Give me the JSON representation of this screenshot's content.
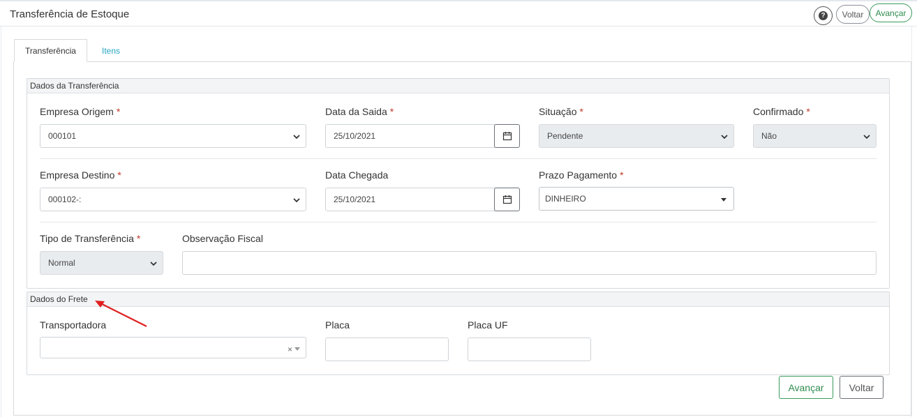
{
  "header": {
    "title": "Transferência de Estoque",
    "help_label": "?",
    "back_label": "Voltar",
    "next_label": "Avançar"
  },
  "tabs": [
    {
      "label": "Transferência",
      "active": true
    },
    {
      "label": "Itens",
      "active": false
    }
  ],
  "transfer_section": {
    "legend": "Dados da Transferência",
    "empresa_origem": {
      "label": "Empresa Origem",
      "required": "*",
      "value": "000101"
    },
    "data_saida": {
      "label": "Data da Saida",
      "required": "*",
      "value": "25/10/2021"
    },
    "situacao": {
      "label": "Situação",
      "required": "*",
      "value": "Pendente"
    },
    "confirmado": {
      "label": "Confirmado",
      "required": "*",
      "value": "Não"
    },
    "empresa_destino": {
      "label": "Empresa Destino",
      "required": "*",
      "value": "000102-:"
    },
    "data_chegada": {
      "label": "Data Chegada",
      "value": "25/10/2021"
    },
    "prazo_pagamento": {
      "label": "Prazo Pagamento",
      "required": "*",
      "value": "DINHEIRO"
    },
    "tipo_transferencia": {
      "label": "Tipo de Transferência",
      "required": "*",
      "value": "Normal"
    },
    "observacao_fiscal": {
      "label": "Observação Fiscal",
      "value": ""
    }
  },
  "freight_section": {
    "legend": "Dados do Frete",
    "transportadora": {
      "label": "Transportadora",
      "value": "",
      "clear_symbol": "×"
    },
    "placa": {
      "label": "Placa",
      "value": ""
    },
    "placa_uf": {
      "label": "Placa UF",
      "value": ""
    }
  },
  "footer": {
    "next_label": "Avançar",
    "back_label": "Voltar"
  },
  "colors": {
    "accent_green": "#2e8b4e",
    "tab_link": "#2aa6c4",
    "required": "#c0392b",
    "annotation_arrow": "#e02020"
  }
}
